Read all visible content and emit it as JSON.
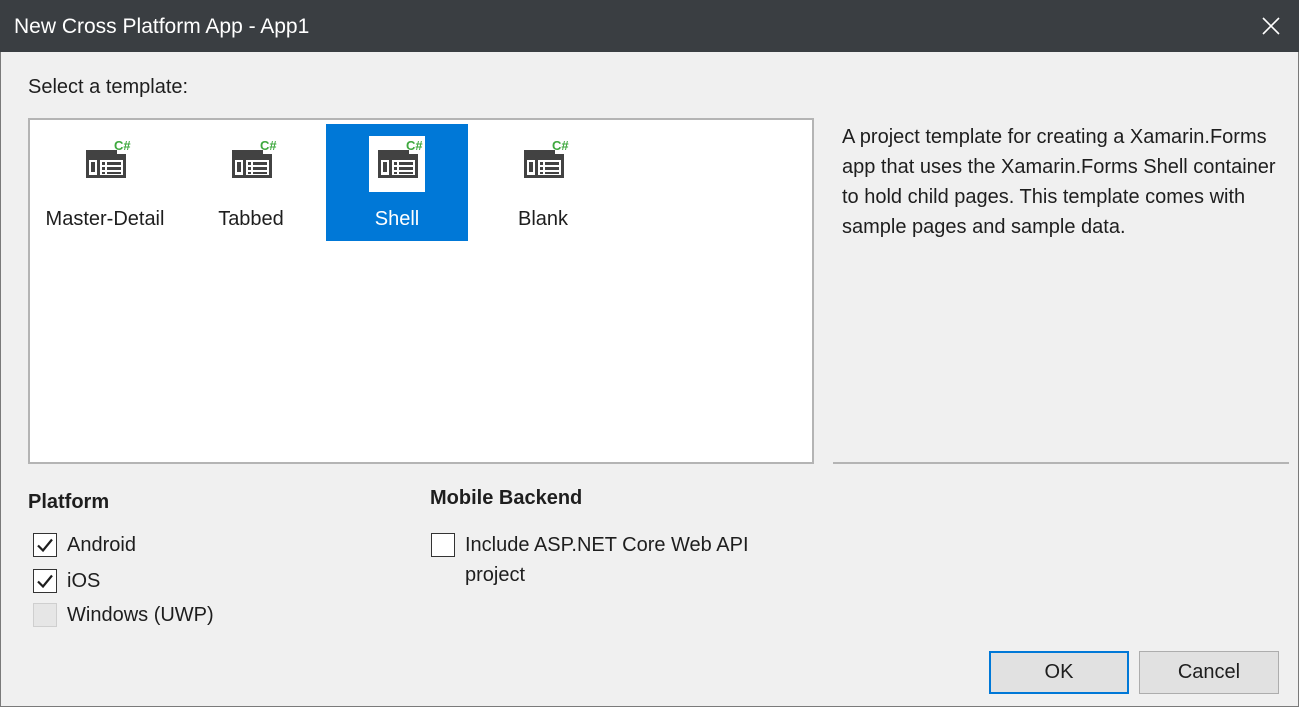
{
  "window": {
    "title": "New Cross Platform App - App1"
  },
  "templates": {
    "label": "Select a template:",
    "items": [
      {
        "label": "Master-Detail",
        "selected": false
      },
      {
        "label": "Tabbed",
        "selected": false
      },
      {
        "label": "Shell",
        "selected": true
      },
      {
        "label": "Blank",
        "selected": false
      }
    ],
    "icon_badge": "C#",
    "description": "A project template for creating a Xamarin.Forms app that uses the Xamarin.Forms Shell container to hold child pages. This template comes with sample pages and sample data."
  },
  "platform": {
    "heading": "Platform",
    "options": [
      {
        "label": "Android",
        "checked": true,
        "enabled": true
      },
      {
        "label": "iOS",
        "checked": true,
        "enabled": true
      },
      {
        "label": "Windows (UWP)",
        "checked": false,
        "enabled": false
      }
    ]
  },
  "backend": {
    "heading": "Mobile Backend",
    "option": {
      "label": "Include ASP.NET Core Web API project",
      "checked": false
    }
  },
  "buttons": {
    "ok": "OK",
    "cancel": "Cancel"
  },
  "colors": {
    "accent": "#0078d7",
    "titlebar": "#3a3e42",
    "csharp_badge": "#3ea83e",
    "background": "#f0f0f0"
  }
}
